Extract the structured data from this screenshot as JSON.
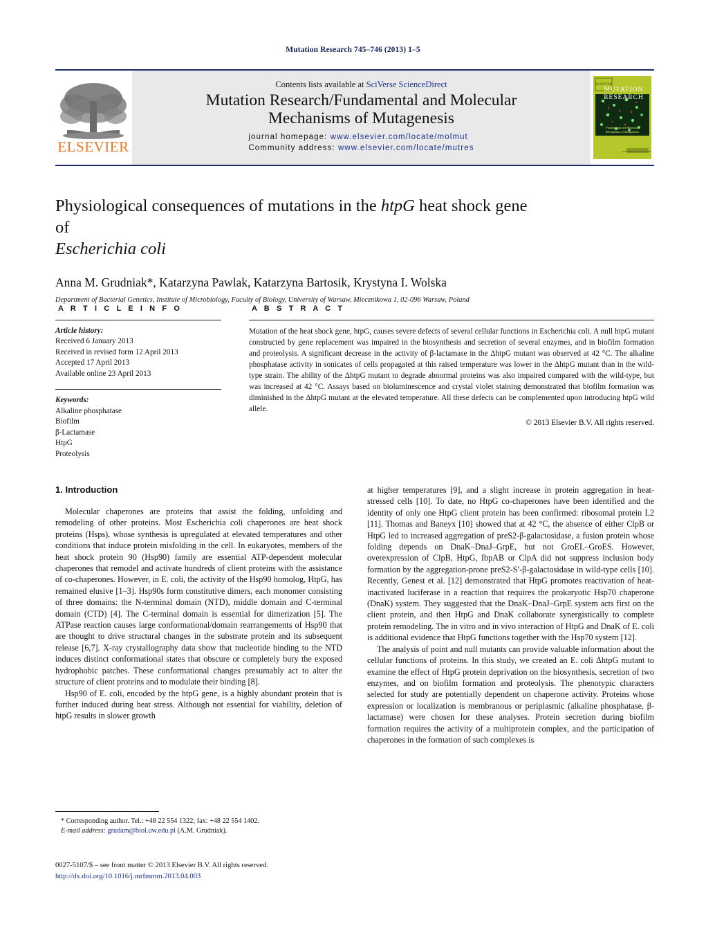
{
  "running_head": "Mutation Research 745–746 (2013) 1–5",
  "masthead": {
    "contents_prefix": "Contents lists available at ",
    "contents_link": "SciVerse ScienceDirect",
    "journal_title_line1": "Mutation Research/Fundamental and Molecular",
    "journal_title_line2": "Mechanisms of Mutagenesis",
    "homepage_label": "journal homepage: ",
    "homepage_url": "www.elsevier.com/locate/molmut",
    "community_label": "Community address: ",
    "community_url": "www.elsevier.com/locate/mutres",
    "publisher_logo_text": "ELSEVIER",
    "cover_title_line1": "MUTATION",
    "cover_title_line2": "RESEARCH",
    "cover_subtitle": "Fundamental and Molecular Mechanisms of Mutagenesis",
    "cover_footer": "www.elsevier.com/locate/mutres",
    "accent_blue": "#1b2f8a",
    "band_gray": "#e9e9ea",
    "elsevier_orange": "#e87722",
    "cover_green": "#b5c72a"
  },
  "article": {
    "title_part1": "Physiological consequences of mutations in the ",
    "title_italic1": "htpG",
    "title_part2": " heat shock gene of",
    "title_italic2": "Escherichia coli",
    "authors": "Anna M. Grudniak*, Katarzyna Pawlak, Katarzyna Bartosik, Krystyna I. Wolska",
    "affiliation": "Department of Bacterial Genetics, Institute of Microbiology, Faculty of Biology, University of Warsaw, Miecznikowa 1, 02-096 Warsaw, Poland"
  },
  "article_info": {
    "heading": "A R T I C L E   I N F O",
    "history_label": "Article history:",
    "history": [
      "Received 6 January 2013",
      "Received in revised form 12 April 2013",
      "Accepted 17 April 2013",
      "Available online 23 April 2013"
    ],
    "keywords_label": "Keywords:",
    "keywords": [
      "Alkaline phosphatase",
      "Biofilm",
      "β-Lactamase",
      "HtpG",
      "Proteolysis"
    ]
  },
  "abstract": {
    "heading": "A B S T R A C T",
    "text": "Mutation of the heat shock gene, htpG, causes severe defects of several cellular functions in Escherichia coli. A null htpG mutant constructed by gene replacement was impaired in the biosynthesis and secretion of several enzymes, and in biofilm formation and proteolysis. A significant decrease in the activity of β-lactamase in the ΔhtpG mutant was observed at 42 °C. The alkaline phosphatase activity in sonicates of cells propagated at this raised temperature was lower in the ΔhtpG mutant than in the wild-type strain. The ability of the ΔhtpG mutant to degrade abnormal proteins was also impaired compared with the wild-type, but was increased at 42 °C. Assays based on bioluminescence and crystal violet staining demonstrated that biofilm formation was diminished in the ΔhtpG mutant at the elevated temperature. All these defects can be complemented upon introducing htpG wild allele.",
    "copyright": "© 2013 Elsevier B.V. All rights reserved."
  },
  "introduction": {
    "heading": "1.  Introduction",
    "left_paragraphs": [
      "Molecular chaperones are proteins that assist the folding, unfolding and remodeling of other proteins. Most Escherichia coli chaperones are heat shock proteins (Hsps), whose synthesis is upregulated at elevated temperatures and other conditions that induce protein misfolding in the cell. In eukaryotes, members of the heat shock protein 90 (Hsp90) family are essential ATP-dependent molecular chaperones that remodel and activate hundreds of client proteins with the assistance of co-chaperones. However, in E. coli, the activity of the Hsp90 homolog, HtpG, has remained elusive [1–3]. Hsp90s form constitutive dimers, each monomer consisting of three domains: the N-terminal domain (NTD), middle domain and C-terminal domain (CTD) [4]. The C-terminal domain is essential for dimerization [5]. The ATPase reaction causes large conformational/domain rearrangements of Hsp90 that are thought to drive structural changes in the substrate protein and its subsequent release [6,7]. X-ray crystallography data show that nucleotide binding to the NTD induces distinct conformational states that obscure or completely bury the exposed hydrophobic patches. These conformational changes presumably act to alter the structure of client proteins and to modulate their binding [8].",
      "Hsp90 of E. coli, encoded by the htpG gene, is a highly abundant protein that is further induced during heat stress. Although not essential for viability, deletion of htpG results in slower growth"
    ],
    "right_paragraphs": [
      "at higher temperatures [9], and a slight increase in protein aggregation in heat-stressed cells [10]. To date, no HtpG co-chaperones have been identified and the identity of only one HtpG client protein has been confirmed: ribosomal protein L2 [11]. Thomas and Baneyx [10] showed that at 42 °C, the absence of either ClpB or HtpG led to increased aggregation of preS2-β-galactosidase, a fusion protein whose folding depends on DnaK–DnaJ–GrpE, but not GroEL–GroES. However, overexpression of ClpB, HtpG, IbpAB or ClpA did not suppress inclusion body formation by the aggregation-prone preS2-S′-β-galactosidase in wild-type cells [10]. Recently, Genest et al. [12] demonstrated that HtpG promotes reactivation of heat-inactivated luciferase in a reaction that requires the prokaryotic Hsp70 chaperone (DnaK) system. They suggested that the DnaK–DnaJ–GrpE system acts first on the client protein, and then HtpG and DnaK collaborate synergistically to complete protein remodeling. The in vitro and in vivo interaction of HtpG and DnaK of E. coli is additional evidence that HtpG functions together with the Hsp70 system [12].",
      "The analysis of point and null mutants can provide valuable information about the cellular functions of proteins. In this study, we created an E. coli ΔhtpG mutant to examine the effect of HtpG protein deprivation on the biosynthesis, secretion of two enzymes, and on biofilm formation and proteolysis. The phenotypic characters selected for study are potentially dependent on chaperone activity. Proteins whose expression or localization is membranous or periplasmic (alkaline phosphatase, β-lactamase) were chosen for these analyses. Protein secretion during biofilm formation requires the activity of a multiprotein complex, and the participation of chaperones in the formation of such complexes is"
    ]
  },
  "footnotes": {
    "corresponding": "* Corresponding author. Tel.: +48 22 554 1322; fax: +48 22 554 1402.",
    "email_label": "E-mail address:",
    "email": "grudam@biol.uw.edu.pl",
    "email_suffix": "(A.M. Grudniak).",
    "front_matter": "0027-5107/$ – see front matter © 2013 Elsevier B.V. All rights reserved.",
    "doi": "http://dx.doi.org/10.1016/j.mrfmmm.2013.04.003"
  }
}
